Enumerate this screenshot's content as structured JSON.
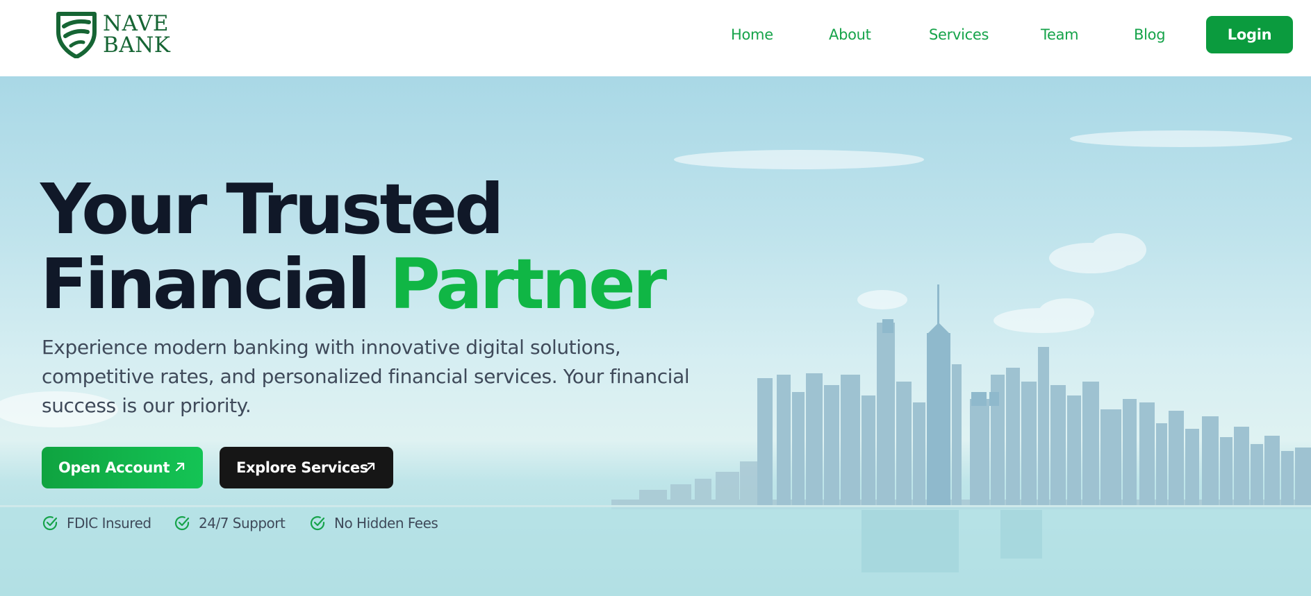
{
  "brand": {
    "line1": "NAVE",
    "line2": "BANK",
    "logo_icon": "shield-icon",
    "color": "#166534"
  },
  "nav": {
    "items": [
      {
        "label": "Home"
      },
      {
        "label": "About"
      },
      {
        "label": "Services"
      },
      {
        "label": "Team"
      },
      {
        "label": "Blog"
      }
    ],
    "login_label": "Login"
  },
  "hero": {
    "title_line1": "Your Trusted",
    "title_line2_plain": "Financial",
    "title_line2_accent": "Partner",
    "subtitle": "Experience modern banking with innovative digital solutions, competitive rates, and personalized financial services. Your financial success is our priority.",
    "buttons": {
      "primary_label": "Open Account",
      "primary_icon": "arrow-up-right-icon",
      "secondary_label": "Explore Services",
      "secondary_icon": "arrow-up-right-icon"
    },
    "badges": [
      {
        "label": "FDIC Insured",
        "icon": "check-circle-icon"
      },
      {
        "label": "24/7 Support",
        "icon": "check-circle-icon"
      },
      {
        "label": "No Hidden Fees",
        "icon": "check-circle-icon"
      }
    ]
  },
  "colors": {
    "brand_green": "#16a34a",
    "accent_green": "#10b645",
    "dark": "#101828",
    "button_dark": "#161616"
  }
}
